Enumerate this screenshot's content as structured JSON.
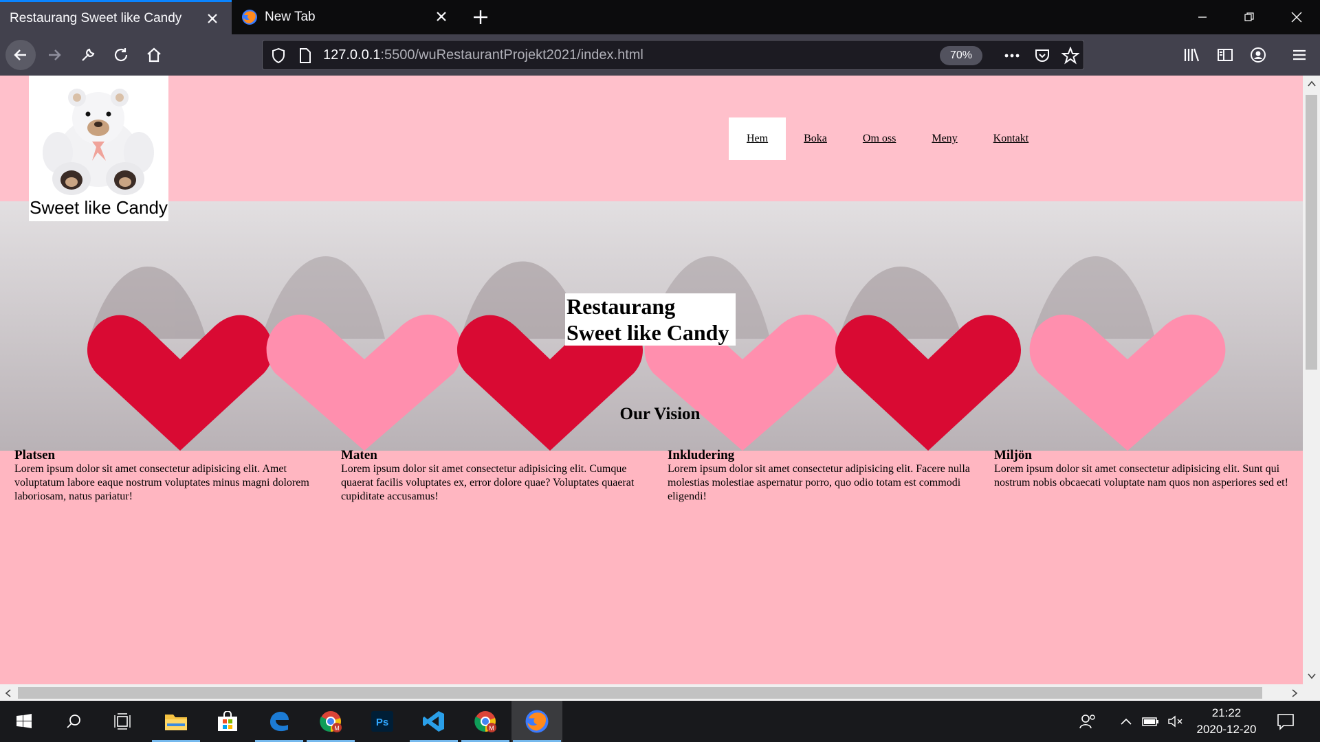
{
  "browser": {
    "tabs": [
      {
        "label": "Restaurang Sweet like Candy",
        "active": true
      },
      {
        "label": "New Tab",
        "active": false
      }
    ],
    "url_host": "127.0.0.1",
    "url_path": ":5500/wuRestaurantProjekt2021/index.html",
    "zoom": "70%"
  },
  "site": {
    "logo_text": "Sweet like Candy",
    "nav": [
      "Hem",
      "Boka",
      "Om oss",
      "Meny",
      "Kontakt"
    ],
    "hero_line1": "Restaurang",
    "hero_line2": "Sweet like Candy",
    "vision_title": "Our Vision",
    "columns": [
      {
        "title": "Platsen",
        "text": "Lorem ipsum dolor sit amet consectetur adipisicing elit. Amet voluptatum labore eaque nostrum voluptates minus magni dolorem laboriosam, natus pariatur!"
      },
      {
        "title": "Maten",
        "text": "Lorem ipsum dolor sit amet consectetur adipisicing elit. Cumque quaerat facilis voluptates ex, error dolore quae? Voluptates quaerat cupiditate accusamus!"
      },
      {
        "title": "Inkludering",
        "text": "Lorem ipsum dolor sit amet consectetur adipisicing elit. Facere nulla molestias molestiae aspernatur porro, quo odio totam est commodi eligendi!"
      },
      {
        "title": "Miljön",
        "text": "Lorem ipsum dolor sit amet consectetur adipisicing elit. Sunt qui nostrum nobis obcaecati voluptate nam quos non asperiores sed et!"
      }
    ]
  },
  "taskbar": {
    "time": "21:22",
    "date": "2020-12-20"
  },
  "colors": {
    "header_bg": "#ffc0cb",
    "page_bg": "#ffb6c1",
    "heart_red": "#d90a33",
    "heart_pink": "#ff8fae",
    "accent": "#0a84ff"
  }
}
